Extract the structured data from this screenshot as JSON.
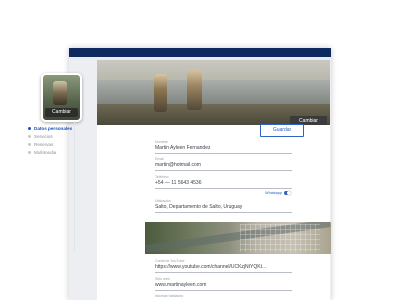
{
  "cover": {
    "change_button": "Cambiar"
  },
  "avatar": {
    "change_button": "Cambiar"
  },
  "nav": {
    "items": [
      {
        "label": "Datos personales",
        "active": true
      },
      {
        "label": "Servicios",
        "active": false
      },
      {
        "label": "Reservas",
        "active": false
      },
      {
        "label": "Multimedia",
        "active": false
      }
    ]
  },
  "form": {
    "save_label": "Guardar",
    "fields": [
      {
        "label": "Nombre",
        "value": "Martin Ayleen Fernandez"
      },
      {
        "label": "Email",
        "value": "martin@hotmail.com"
      },
      {
        "label": "Teléfono",
        "value": "+54  —  11 5643 4536"
      },
      {
        "label": "Ubicación",
        "value": "Salto, Departamento de Salto, Uruguay"
      },
      {
        "label": "Canal de YouTube",
        "value": "https://www.youtube.com/channel/UCKzjNtYQKt..."
      },
      {
        "label": "Sitio web",
        "value": "www.martinayleen.com"
      },
      {
        "label": "Idiomas hablados",
        "value": ""
      }
    ],
    "whatsapp_label": "Whatsapp"
  },
  "colors": {
    "header": "#0e2a5e",
    "accent": "#2f63c4"
  }
}
